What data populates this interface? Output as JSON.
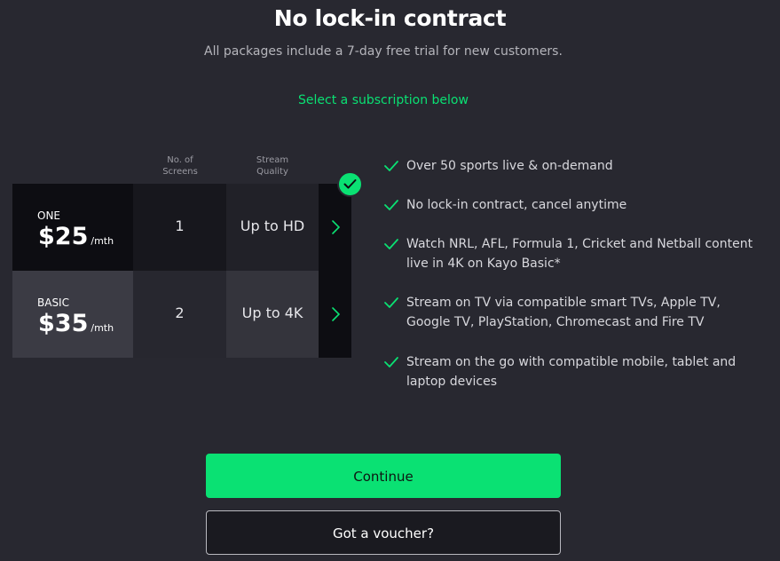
{
  "header": {
    "title": "No lock-in contract",
    "subtitle": "All packages include a 7-day free trial for new customers.",
    "select_prompt": "Select a subscription below"
  },
  "table": {
    "columns": {
      "screens_line1": "No. of",
      "screens_line2": "Screens",
      "quality_line1": "Stream",
      "quality_line2": "Quality"
    },
    "plans": [
      {
        "name": "ONE",
        "price": "$25",
        "period": "/mth",
        "screens": "1",
        "quality": "Up to HD",
        "selected": true
      },
      {
        "name": "BASIC",
        "price": "$35",
        "period": "/mth",
        "screens": "2",
        "quality": "Up to 4K",
        "selected": false
      }
    ]
  },
  "features": [
    "Over 50 sports live & on-demand",
    "No lock-in contract, cancel anytime",
    "Watch NRL, AFL, Formula 1, Cricket and Netball content live in 4K on Kayo Basic*",
    "Stream on TV via compatible smart TVs, Apple TV, Google TV, PlayStation, Chromecast and Fire TV",
    "Stream on the go with compatible mobile, tablet and laptop devices"
  ],
  "buttons": {
    "continue_label": "Continue",
    "voucher_label": "Got a voucher?"
  },
  "colors": {
    "accent": "#0ae173",
    "background": "#282830"
  }
}
